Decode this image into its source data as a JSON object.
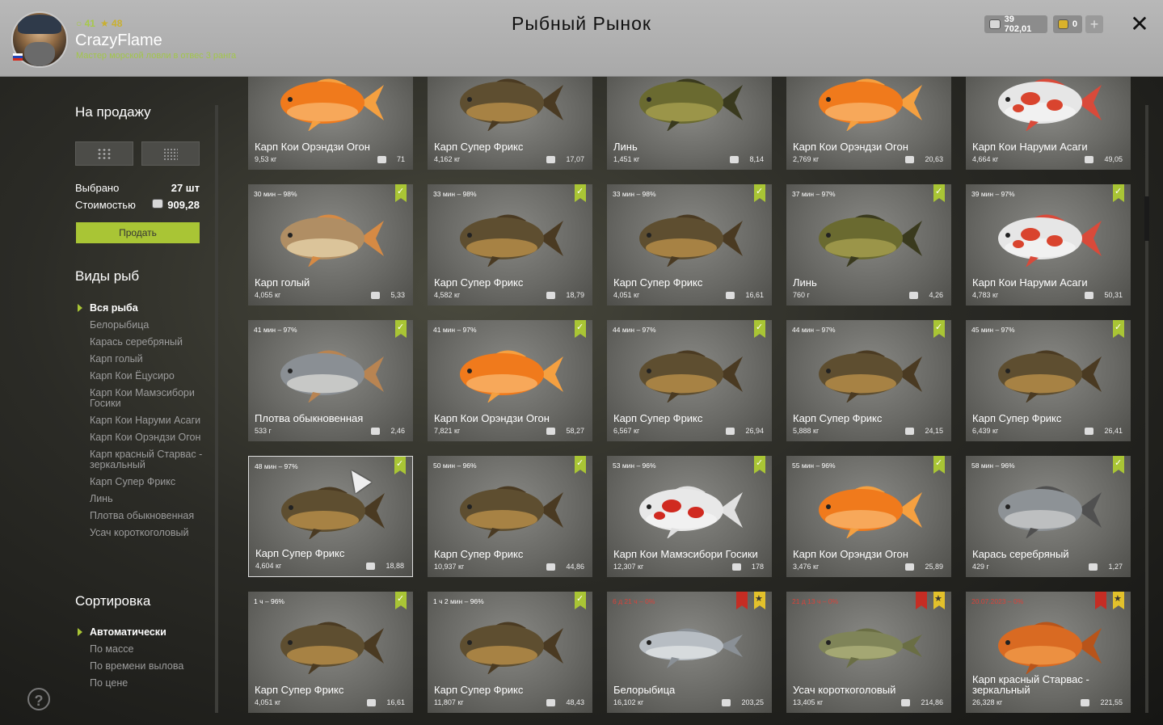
{
  "header": {
    "title": "Рыбный Рынок",
    "username": "CrazyFlame",
    "level": "41",
    "rank_level": "48",
    "rank_title": "Мастер морской ловли в отвес 3 ранга",
    "silver": "39 702,01",
    "gold": "0",
    "plus_label": "+",
    "close_label": "✕"
  },
  "sidebar": {
    "for_sale_title": "На продажу",
    "selected_label": "Выбрано",
    "selected_value": "27 шт",
    "cost_label": "Стоимостью",
    "cost_value": "909,28",
    "sell_label": "Продать",
    "species_title": "Виды рыб",
    "species": [
      "Вся рыба",
      "Белорыбица",
      "Карась серебряный",
      "Карп голый",
      "Карп Кои Ёцусиро",
      "Карп Кои Мамэсибори Госики",
      "Карп Кои Наруми Асаги",
      "Карп Кои Орэндзи Огон",
      "Карп красный Старвас - зеркальный",
      "Карп Супер Фрикс",
      "Линь",
      "Плотва обыкновенная",
      "Усач короткоголовый"
    ],
    "sort_title": "Сортировка",
    "sort": [
      "Автоматически",
      "По массе",
      "По времени вылова",
      "По цене"
    ],
    "help_label": "?"
  },
  "icons": {
    "close": "close-icon",
    "grid": "grid-icon",
    "coin": "coin-icon",
    "help": "help-icon",
    "check": "check-icon",
    "star": "star-icon"
  },
  "colors": {
    "accent": "#a9c535",
    "red": "#c52d24",
    "gold": "#e3c12b"
  },
  "cards": [
    {
      "time": "",
      "name": "Карп Кои Орэндзи Огон",
      "weight": "9,53 кг",
      "price": "71",
      "fish": "orange",
      "badges": []
    },
    {
      "time": "",
      "name": "Карп Супер Фрикс",
      "weight": "4,162 кг",
      "price": "17,07",
      "fish": "carp",
      "badges": []
    },
    {
      "time": "",
      "name": "Линь",
      "weight": "1,451 кг",
      "price": "8,14",
      "fish": "tench",
      "badges": []
    },
    {
      "time": "",
      "name": "Карп Кои Орэндзи Огон",
      "weight": "2,769 кг",
      "price": "20,63",
      "fish": "orange",
      "badges": []
    },
    {
      "time": "",
      "name": "Карп Кои Наруми Асаги",
      "weight": "4,664 кг",
      "price": "49,05",
      "fish": "koi-red",
      "badges": []
    },
    {
      "time": "30 мин – 98%",
      "name": "Карп голый",
      "weight": "4,055 кг",
      "price": "5,33",
      "fish": "mirror",
      "badges": [
        "check"
      ]
    },
    {
      "time": "33 мин – 98%",
      "name": "Карп Супер Фрикс",
      "weight": "4,582 кг",
      "price": "18,79",
      "fish": "carp",
      "badges": [
        "check"
      ]
    },
    {
      "time": "33 мин – 98%",
      "name": "Карп Супер Фрикс",
      "weight": "4,051 кг",
      "price": "16,61",
      "fish": "carp",
      "badges": [
        "check"
      ]
    },
    {
      "time": "37 мин – 97%",
      "name": "Линь",
      "weight": "760 г",
      "price": "4,26",
      "fish": "tench",
      "badges": [
        "check"
      ]
    },
    {
      "time": "39 мин – 97%",
      "name": "Карп Кои Наруми Асаги",
      "weight": "4,783 кг",
      "price": "50,31",
      "fish": "koi-red",
      "badges": [
        "check"
      ]
    },
    {
      "time": "41 мин – 97%",
      "name": "Плотва обыкновенная",
      "weight": "533 г",
      "price": "2,46",
      "fish": "roach",
      "badges": [
        "check"
      ]
    },
    {
      "time": "41 мин – 97%",
      "name": "Карп Кои Орэндзи Огон",
      "weight": "7,821 кг",
      "price": "58,27",
      "fish": "orange",
      "badges": [
        "check"
      ]
    },
    {
      "time": "44 мин – 97%",
      "name": "Карп Супер Фрикс",
      "weight": "6,567 кг",
      "price": "26,94",
      "fish": "carp",
      "badges": [
        "check"
      ]
    },
    {
      "time": "44 мин – 97%",
      "name": "Карп Супер Фрикс",
      "weight": "5,888 кг",
      "price": "24,15",
      "fish": "carp",
      "badges": [
        "check"
      ]
    },
    {
      "time": "45 мин – 97%",
      "name": "Карп Супер Фрикс",
      "weight": "6,439 кг",
      "price": "26,41",
      "fish": "carp",
      "badges": [
        "check"
      ]
    },
    {
      "time": "48 мин – 97%",
      "name": "Карп Супер Фрикс",
      "weight": "4,604 кг",
      "price": "18,88",
      "fish": "carp",
      "badges": [
        "check"
      ],
      "selected": true
    },
    {
      "time": "50 мин – 96%",
      "name": "Карп Супер Фрикс",
      "weight": "10,937 кг",
      "price": "44,86",
      "fish": "carp",
      "badges": [
        "check"
      ]
    },
    {
      "time": "53 мин – 96%",
      "name": "Карп Кои Мамэсибори Госики",
      "weight": "12,307 кг",
      "price": "178",
      "fish": "koi-spot",
      "badges": [
        "check"
      ]
    },
    {
      "time": "55 мин – 96%",
      "name": "Карп Кои Орэндзи Огон",
      "weight": "3,476 кг",
      "price": "25,89",
      "fish": "orange",
      "badges": [
        "check"
      ]
    },
    {
      "time": "58 мин – 96%",
      "name": "Карась серебряный",
      "weight": "429 г",
      "price": "1,27",
      "fish": "crucian",
      "badges": [
        "check"
      ]
    },
    {
      "time": "1 ч – 96%",
      "name": "Карп Супер Фрикс",
      "weight": "4,051 кг",
      "price": "16,61",
      "fish": "carp",
      "badges": [
        "check"
      ]
    },
    {
      "time": "1 ч 2 мин – 96%",
      "name": "Карп Супер Фрикс",
      "weight": "11,807 кг",
      "price": "48,43",
      "fish": "carp",
      "badges": [
        "check"
      ]
    },
    {
      "time": "6 д 21 ч – 0%",
      "name": "Белорыбица",
      "weight": "16,102 кг",
      "price": "203,25",
      "fish": "whitefish",
      "badges": [
        "red",
        "star"
      ],
      "red": true
    },
    {
      "time": "21 д 13 ч – 0%",
      "name": "Усач короткоголовый",
      "weight": "13,405 кг",
      "price": "214,86",
      "fish": "barbel",
      "badges": [
        "red",
        "star"
      ],
      "red": true
    },
    {
      "time": "20.07.2023 – 0%",
      "name": "Карп красный Старвас - зеркальный",
      "weight": "26,328 кг",
      "price": "221,55",
      "fish": "red-mirror",
      "badges": [
        "red",
        "star"
      ],
      "red": true
    }
  ]
}
